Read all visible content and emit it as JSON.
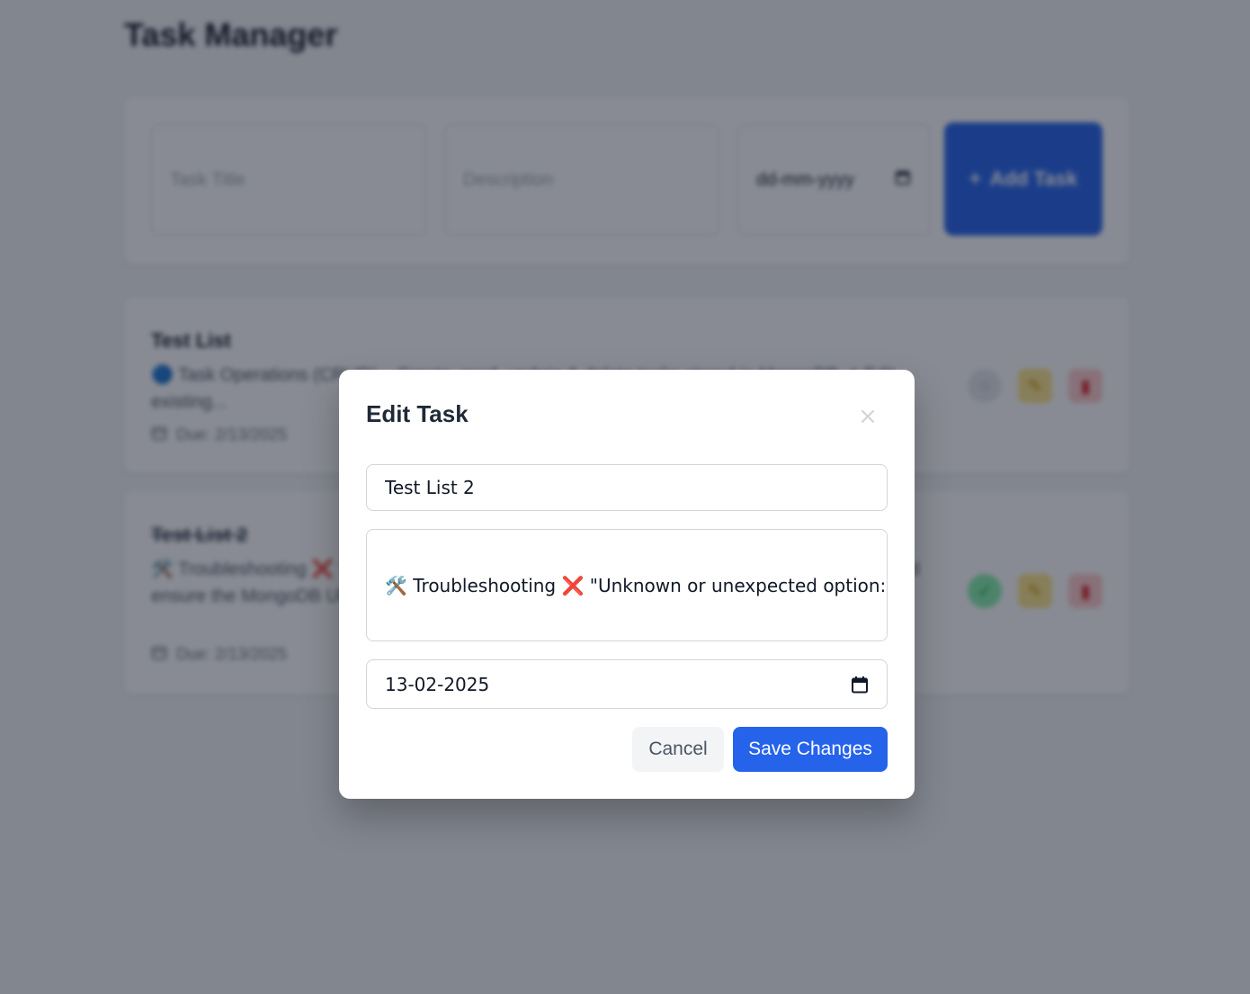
{
  "app": {
    "title": "Task Manager"
  },
  "add_form": {
    "title_placeholder": "Task Title",
    "description_placeholder": "Description",
    "date_placeholder": "dd-mm-yyyy",
    "add_button_label": "Add Task",
    "add_button_icon": "+"
  },
  "tasks": [
    {
      "title": "Test List",
      "description": "🔵 Task Operations (CRUD) – Create, read, update & delete tasks stored in MongoDB ✔ Edit existing...",
      "due": "Due: 2/13/2025",
      "completed": false
    },
    {
      "title": "Test List 2",
      "description": "🛠️ Troubleshooting ❌ \"Unknown or unexpected option: --turbopack\". Check Next.js version and ensure the MongoDB URI is correct in your .env file.",
      "due": "Due: 2/13/2025",
      "completed": true
    }
  ],
  "modal": {
    "heading": "Edit Task",
    "close_label": "×",
    "title_value": "Test List 2",
    "description_value": "🛠️ Troubleshooting ❌ \"Unknown or unexpected option: --tu",
    "description_tools_glyph": "🛠️",
    "description_text_1": " Troubleshooting ",
    "description_cross_glyph": "❌",
    "description_text_2": " \"Unknown or unexpected option: --tu",
    "date_value": "13-02-2025",
    "cancel_label": "Cancel",
    "save_label": "Save Changes"
  },
  "icons": {
    "close": "close-icon",
    "calendar": "calendar-icon",
    "add": "plus-icon",
    "edit": "pencil-icon",
    "delete": "trash-icon",
    "toggle": "check-circle-icon"
  },
  "colors": {
    "primary": "#2563eb",
    "overlay": "rgba(17, 24, 39, 0.5)",
    "edit_bg": "#fde68a",
    "delete_bg": "#fecaca",
    "done_bg": "#86efac"
  }
}
